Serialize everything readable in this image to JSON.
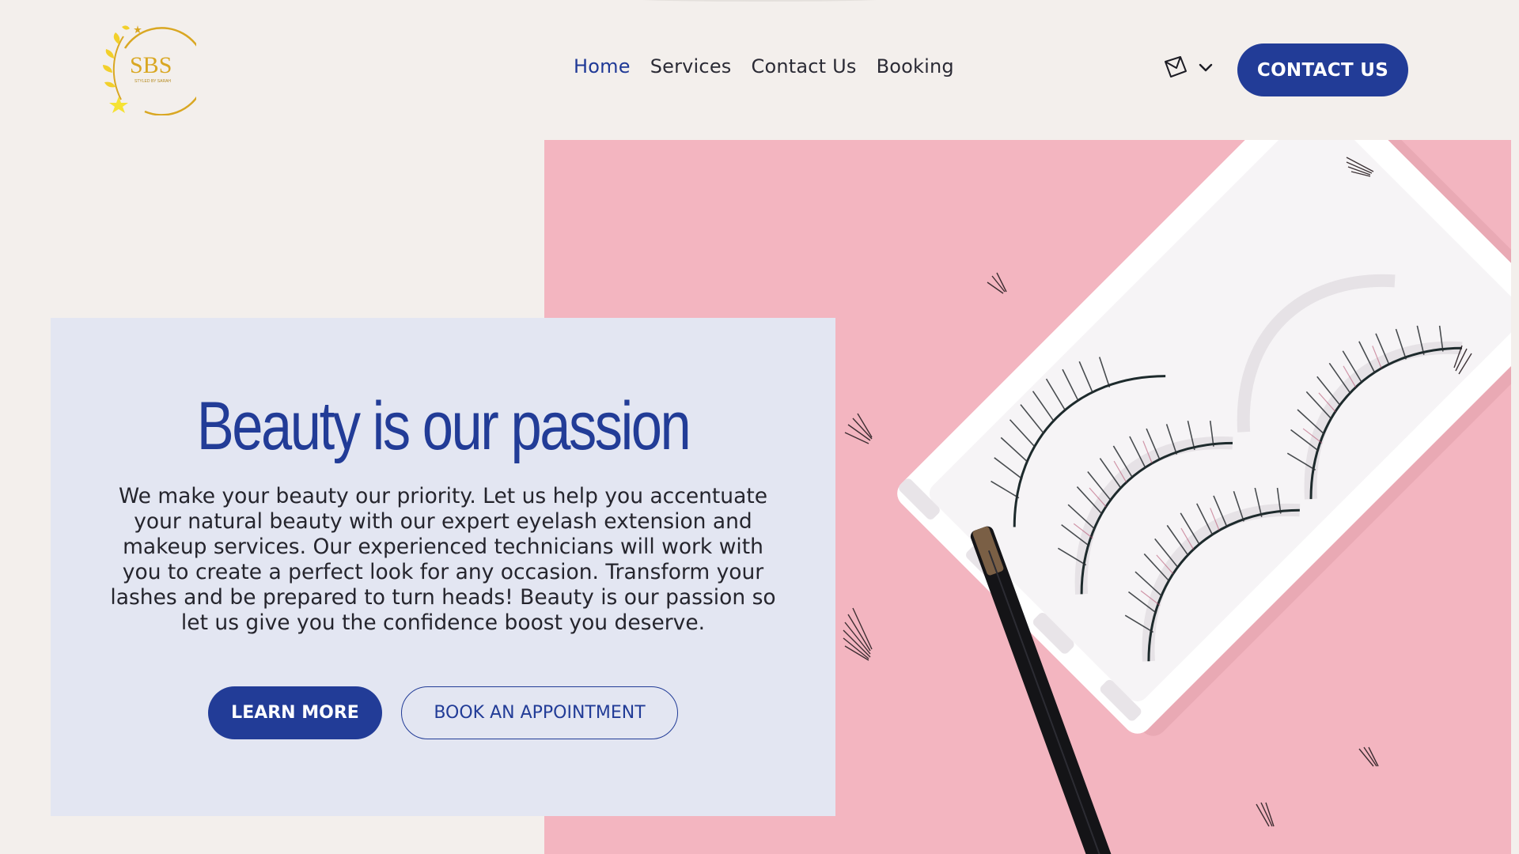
{
  "header": {
    "logo_text": "SBS",
    "logo_tagline": "STYLED BY SARAH",
    "nav": [
      {
        "label": "Home",
        "active": true
      },
      {
        "label": "Services",
        "active": false
      },
      {
        "label": "Contact Us",
        "active": false
      },
      {
        "label": "Booking",
        "active": false
      }
    ],
    "contact_button": "CONTACT US",
    "mail_icon": "mail-icon",
    "dropdown_icon": "chevron-down-icon"
  },
  "hero": {
    "title": "Beauty is our passion",
    "body": "We make your beauty our priority. Let us help you accentuate your natural beauty with our expert eyelash extension and makeup services. Our experienced technicians will work with you to create a perfect look for any occasion. Transform your lashes and be prepared to turn heads! Beauty is our passion so let us give you the confidence boost you deserve.",
    "learn_more": "LEARN MORE",
    "book": "BOOK AN APPOINTMENT"
  },
  "colors": {
    "brand": "#223c97",
    "background": "#f3efec",
    "card": "#e3e6f2",
    "image_pink": "#f3b5c0",
    "logo_gold": "#d9a722"
  }
}
